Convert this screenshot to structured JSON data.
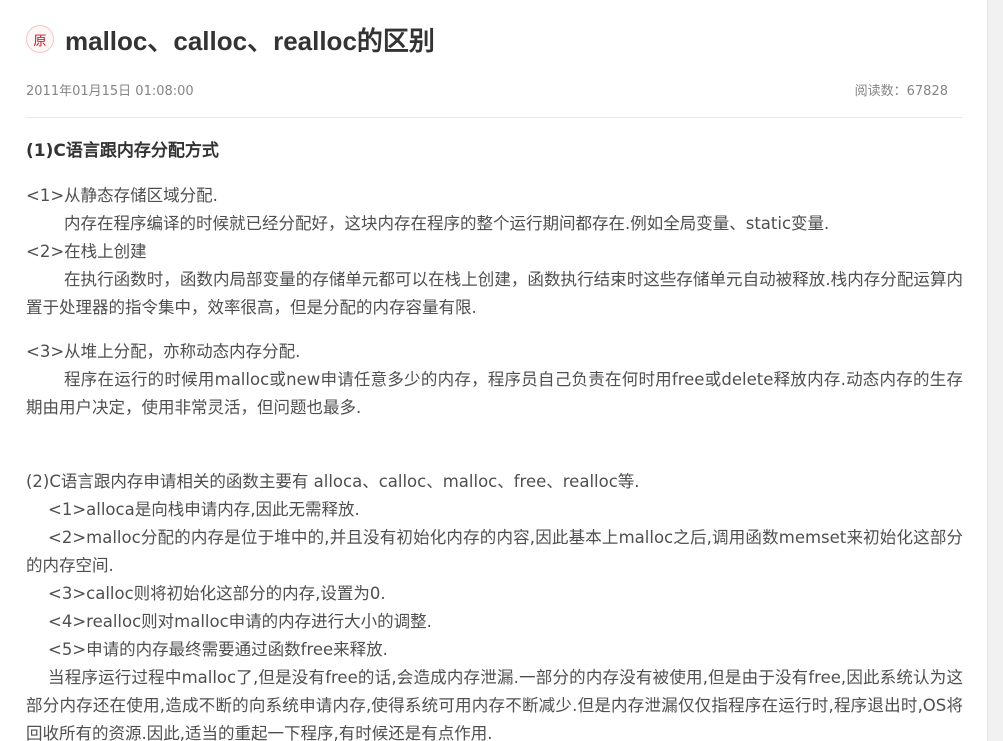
{
  "article": {
    "badge": "原",
    "title": "malloc、calloc、realloc的区别",
    "date": "2011年01月15日 01:08:00",
    "read_count_label": "阅读数：67828"
  },
  "content": {
    "section1_heading": "(1)C语言跟内存分配方式",
    "p1_head": "<1>从静态存储区域分配.",
    "p1_body": "内存在程序编译的时候就已经分配好，这块内存在程序的整个运行期间都存在.例如全局变量、static变量.",
    "p2_head": "<2>在栈上创建",
    "p2_body": "在执行函数时，函数内局部变量的存储单元都可以在栈上创建，函数执行结束时这些存储单元自动被释放.栈内存分配运算内置于处理器的指令集中，效率很高，但是分配的内存容量有限.",
    "p3_head": "<3>从堆上分配，亦称动态内存分配.",
    "p3_body": "程序在运行的时候用malloc或new申请任意多少的内存，程序员自己负责在何时用free或delete释放内存.动态内存的生存期由用户决定，使用非常灵活，但问题也最多.",
    "section2_heading": "(2)C语言跟内存申请相关的函数主要有 alloca、calloc、malloc、free、realloc等.",
    "item1": "<1>alloca是向栈申请内存,因此无需释放.",
    "item2": "<2>malloc分配的内存是位于堆中的,并且没有初始化内存的内容,因此基本上malloc之后,调用函数memset来初始化这部分的内存空间.",
    "item3": "<3>calloc则将初始化这部分的内存,设置为0.",
    "item4": "<4>realloc则对malloc申请的内存进行大小的调整.",
    "item5": "<5>申请的内存最终需要通过函数free来释放.",
    "leak_paragraph": "当程序运行过程中malloc了,但是没有free的话,会造成内存泄漏.一部分的内存没有被使用,但是由于没有free,因此系统认为这部分内存还在使用,造成不断的向系统申请内存,使得系统可用内存不断减少.但是内存泄漏仅仅指程序在运行时,程序退出时,OS将回收所有的资源.因此,适当的重起一下程序,有时候还是有点作用."
  }
}
